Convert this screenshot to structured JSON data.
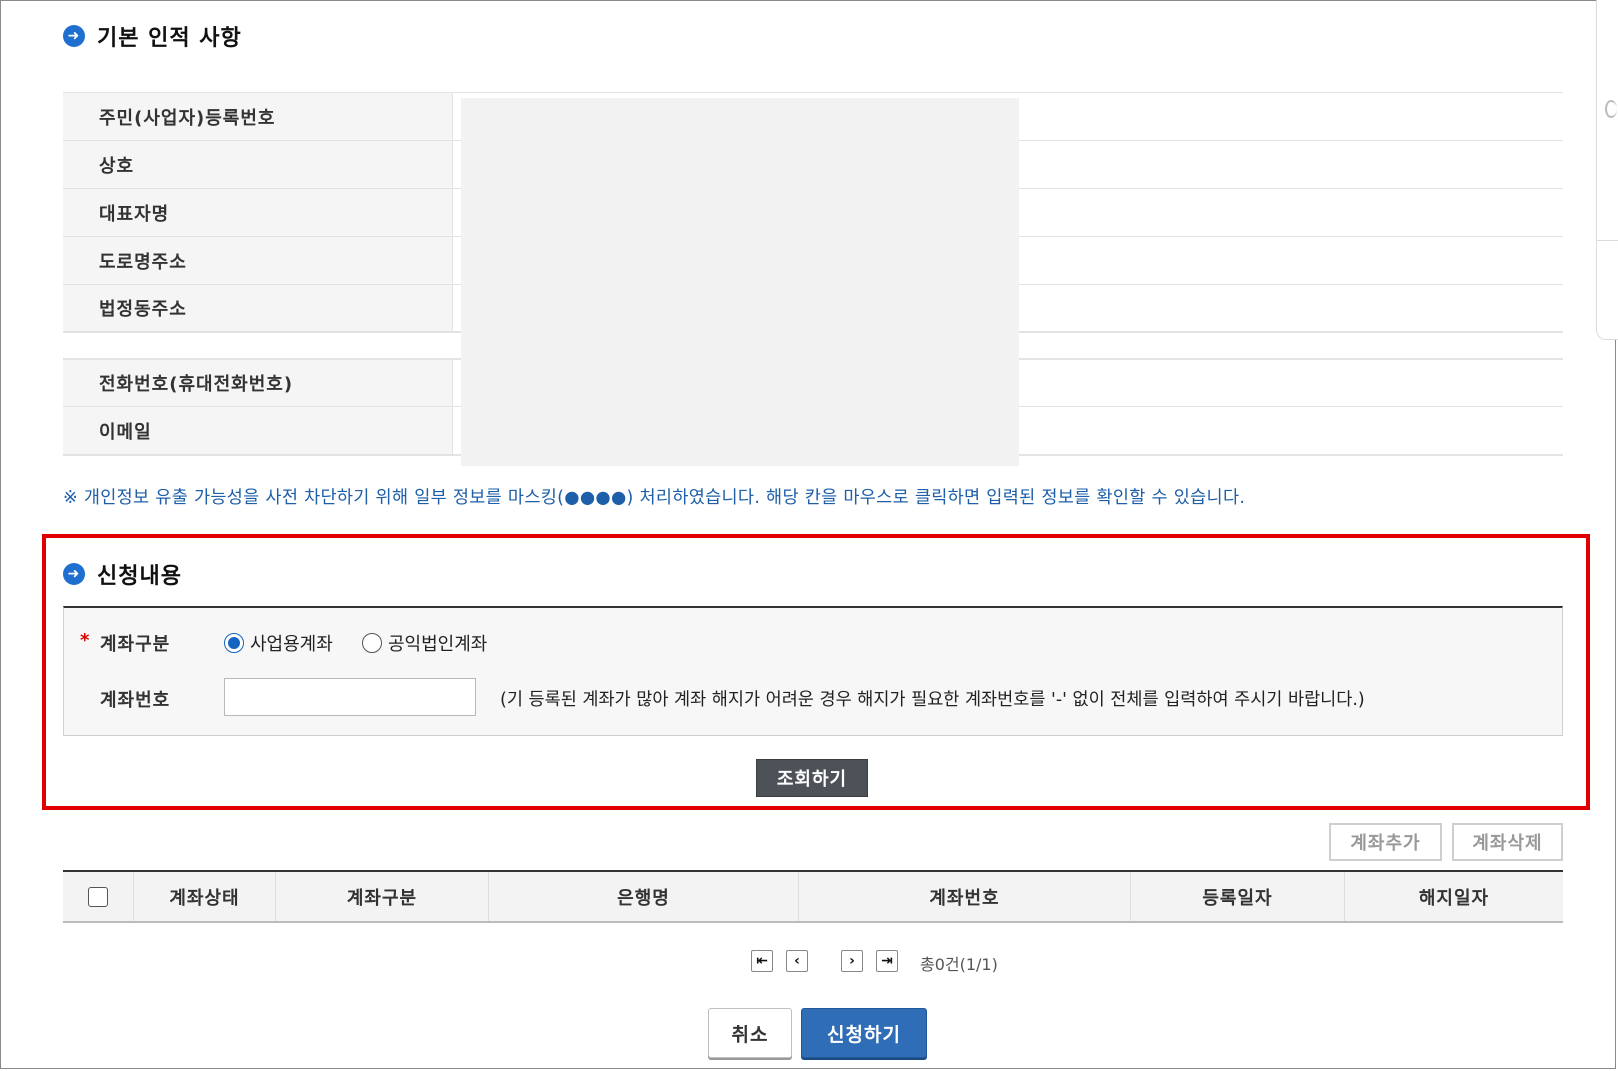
{
  "basic_info": {
    "title": "기본 인적 사항",
    "rows": [
      {
        "label": "주민(사업자)등록번호"
      },
      {
        "label": "상호"
      },
      {
        "label": "대표자명"
      },
      {
        "label": "도로명주소"
      },
      {
        "label": "법정동주소"
      },
      {
        "label": "전화번호(휴대전화번호)"
      },
      {
        "label": "이메일"
      }
    ],
    "notice": "※ 개인정보 유출 가능성을 사전 차단하기 위해 일부 정보를 마스킹(●●●●) 처리하였습니다. 해당 칸을 마우스로 클릭하면 입력된 정보를 확인할 수 있습니다."
  },
  "request": {
    "title": "신청내용",
    "required_mark": "*",
    "account_type_label": "계좌구분",
    "account_type_options": [
      {
        "label": "사업용계좌",
        "checked": true
      },
      {
        "label": "공익법인계좌",
        "checked": false
      }
    ],
    "account_number_label": "계좌번호",
    "account_number_value": "",
    "account_number_hint": "(기 등록된 계좌가 많아 계좌 해지가 어려운 경우 해지가 필요한 계좌번호를 '-' 없이 전체를 입력하여 주시기 바랍니다.)",
    "search_button": "조회하기"
  },
  "account_actions": {
    "add": "계좌추가",
    "delete": "계좌삭제"
  },
  "account_table": {
    "columns": [
      "계좌상태",
      "계좌구분",
      "은행명",
      "계좌번호",
      "등록일자",
      "해지일자"
    ],
    "rows": []
  },
  "pagination": {
    "first_icon": "arrow-first-icon",
    "prev_icon": "chevron-left-icon",
    "next_icon": "chevron-right-icon",
    "last_icon": "arrow-last-icon",
    "summary": "총0건(1/1)"
  },
  "footer": {
    "cancel": "취소",
    "apply": "신청하기"
  },
  "colors": {
    "accent_blue": "#2f6db7",
    "highlight_red": "#e00000",
    "notice_blue": "#1d5fa8"
  }
}
